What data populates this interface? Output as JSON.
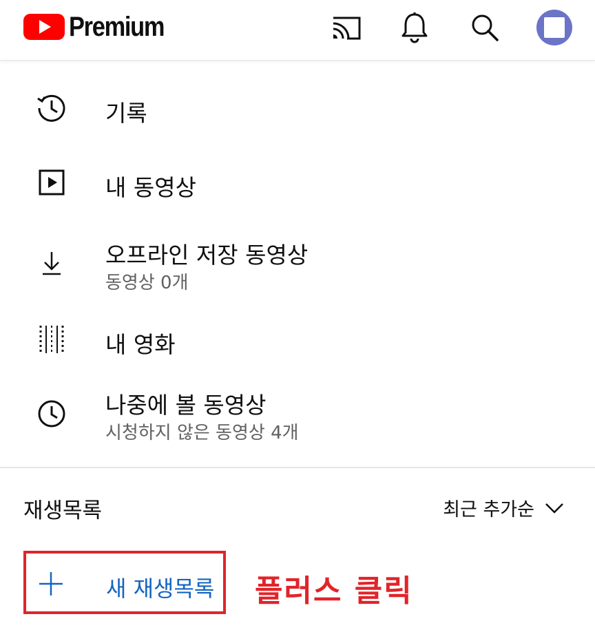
{
  "header": {
    "logo_text": "Premium",
    "icons": [
      "cast-icon",
      "bell-icon",
      "search-icon",
      "avatar"
    ]
  },
  "menu": {
    "items": [
      {
        "icon": "history-icon",
        "label": "기록",
        "sub": ""
      },
      {
        "icon": "play-square-icon",
        "label": "내 동영상",
        "sub": ""
      },
      {
        "icon": "download-icon",
        "label": "오프라인 저장 동영상",
        "sub": "동영상 0개"
      },
      {
        "icon": "film-icon",
        "label": "내 영화",
        "sub": ""
      },
      {
        "icon": "clock-icon",
        "label": "나중에 볼 동영상",
        "sub": "시청하지 않은 동영상 4개"
      }
    ]
  },
  "playlists": {
    "title": "재생목록",
    "sort_label": "최근 추가순",
    "new_playlist_label": "새 재생목록"
  },
  "annotation": {
    "text": "플러스 클릭",
    "color": "#e0242a"
  },
  "colors": {
    "brand_red": "#ff0000",
    "link_blue": "#1464c0",
    "annotation_red": "#e0242a",
    "avatar": "#6b74c6"
  }
}
